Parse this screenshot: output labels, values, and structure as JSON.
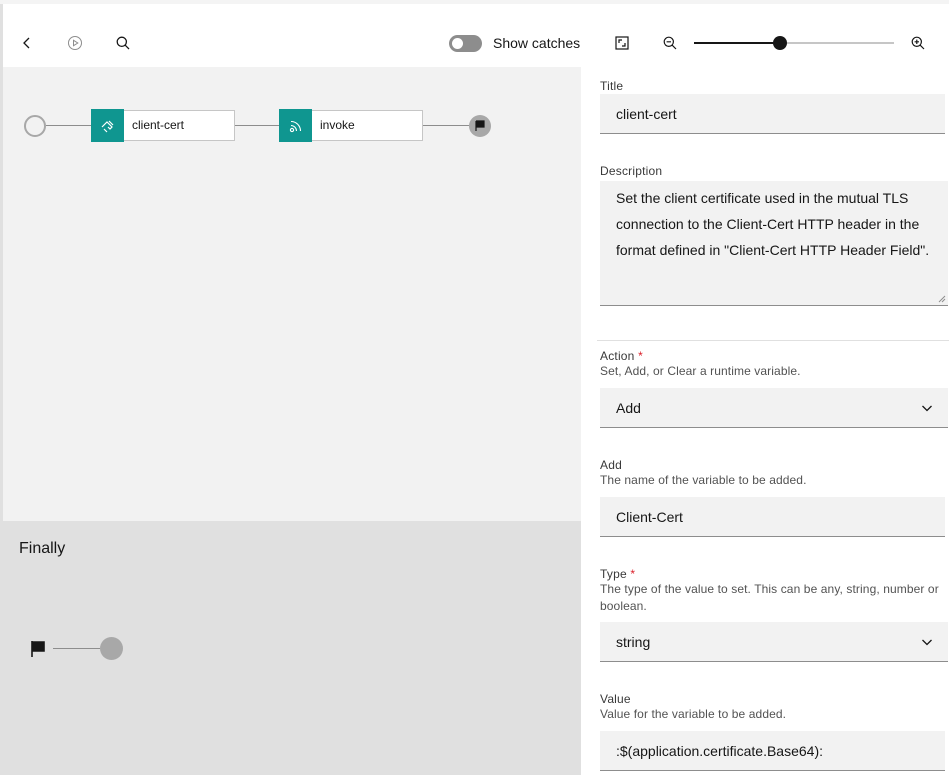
{
  "toolbar": {
    "toggle_label": "Show catches",
    "show_catches": false,
    "zoom_level": 0.43
  },
  "flow": {
    "nodes": [
      {
        "label": "client-cert",
        "icon": "set-variable-icon"
      },
      {
        "label": "invoke",
        "icon": "invoke-icon"
      }
    ]
  },
  "finally": {
    "title": "Finally"
  },
  "panel": {
    "title_label": "Title",
    "title_value": "client-cert",
    "description_label": "Description",
    "description_value": "Set the client certificate used in the mutual TLS connection to the Client-Cert HTTP header in the format defined in \"Client-Cert HTTP Header Field\".",
    "action_label": "Action",
    "action_required": "*",
    "action_helper": "Set, Add, or Clear a runtime variable.",
    "action_value": "Add",
    "add_label": "Add",
    "add_helper": "The name of the variable to be added.",
    "add_value": "Client-Cert",
    "type_label": "Type",
    "type_required": "*",
    "type_helper": "The type of the value to set. This can be any, string, number or boolean.",
    "type_value": "string",
    "value_label": "Value",
    "value_helper": "Value for the variable to be added.",
    "value_value": ":$(application.certificate.Base64):"
  },
  "colors": {
    "accent": "#0f9690",
    "required": "#da1e28"
  }
}
